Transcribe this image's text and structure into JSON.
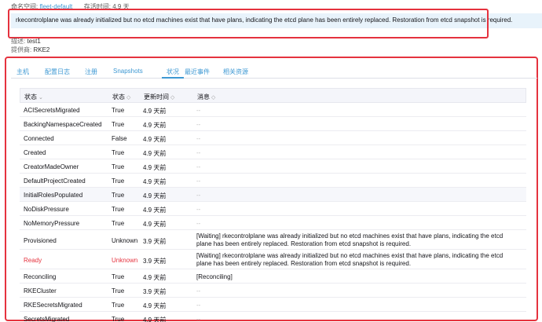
{
  "header": {
    "namespace_label": "命名空间:",
    "namespace_value": "fleet-default",
    "age_label": "存活时间:",
    "age_value": "4.9 天"
  },
  "banner": {
    "message": "rkecontrolplane was already initialized but no etcd machines exist that have plans, indicating the etcd plane has been entirely replaced. Restoration from etcd snapshot is required."
  },
  "details": {
    "description_label": "描述:",
    "description_value": "test1",
    "provider_label": "提供商:",
    "provider_value": "RKE2"
  },
  "tabs": [
    {
      "label": "主机"
    },
    {
      "label": "配置日志"
    },
    {
      "label": "注册"
    },
    {
      "label": "Snapshots"
    },
    {
      "label": "状况"
    },
    {
      "label": "最近事件"
    },
    {
      "label": "相关资源"
    }
  ],
  "active_tab_index": 4,
  "table": {
    "headers": {
      "type": "状态",
      "status": "状态",
      "updated": "更新时间",
      "message": "消息"
    },
    "sort_icons": {
      "type": "⌄",
      "other": "◇"
    },
    "rows": [
      {
        "type": "ACISecretsMigrated",
        "status": "True",
        "updated": "4.9 天前",
        "message": "--"
      },
      {
        "type": "BackingNamespaceCreated",
        "status": "True",
        "updated": "4.9 天前",
        "message": "--"
      },
      {
        "type": "Connected",
        "status": "False",
        "updated": "4.9 天前",
        "message": "--"
      },
      {
        "type": "Created",
        "status": "True",
        "updated": "4.9 天前",
        "message": "--"
      },
      {
        "type": "CreatorMadeOwner",
        "status": "True",
        "updated": "4.9 天前",
        "message": "--"
      },
      {
        "type": "DefaultProjectCreated",
        "status": "True",
        "updated": "4.9 天前",
        "message": "--"
      },
      {
        "type": "InitialRolesPopulated",
        "status": "True",
        "updated": "4.9 天前",
        "message": "--"
      },
      {
        "type": "NoDiskPressure",
        "status": "True",
        "updated": "4.9 天前",
        "message": "--"
      },
      {
        "type": "NoMemoryPressure",
        "status": "True",
        "updated": "4.9 天前",
        "message": "--"
      },
      {
        "type": "Provisioned",
        "status": "Unknown",
        "updated": "3.9 天前",
        "message": "[Waiting] rkecontrolplane was already initialized but no etcd machines exist that have plans, indicating the etcd plane has been entirely replaced. Restoration from etcd snapshot is required."
      },
      {
        "type": "Ready",
        "status": "Unknown",
        "updated": "3.9 天前",
        "message": "[Waiting] rkecontrolplane was already initialized but no etcd machines exist that have plans, indicating the etcd plane has been entirely replaced. Restoration from etcd snapshot is required.",
        "error": true
      },
      {
        "type": "Reconciling",
        "status": "True",
        "updated": "4.9 天前",
        "message": "[Reconciling]"
      },
      {
        "type": "RKECluster",
        "status": "True",
        "updated": "3.9 天前",
        "message": "--"
      },
      {
        "type": "RKESecretsMigrated",
        "status": "True",
        "updated": "4.9 天前",
        "message": "--"
      },
      {
        "type": "SecretsMigrated",
        "status": "True",
        "updated": "4.9 天前",
        "message": "--"
      }
    ]
  },
  "colors": {
    "accent": "#3d98d3",
    "error": "#e5323e",
    "annotation_box": "#e5323e",
    "banner_bg": "#e8f3fb"
  }
}
